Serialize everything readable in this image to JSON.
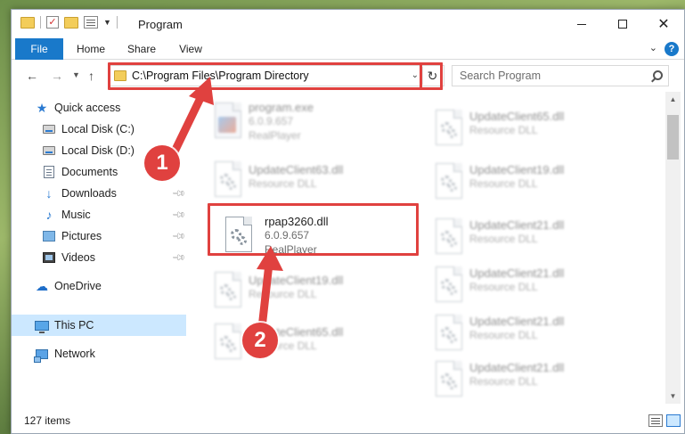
{
  "window": {
    "title": "Program",
    "minimize_icon": "minimize-icon",
    "maximize_icon": "maximize-icon",
    "close_glyph": "✕"
  },
  "ribbon": {
    "tabs": [
      "File",
      "Home",
      "Share",
      "View"
    ],
    "help_glyph": "?"
  },
  "address": {
    "path": "C:\\Program Files\\Program Directory",
    "refresh_glyph": "↻"
  },
  "search": {
    "placeholder": "Search Program"
  },
  "sidebar": {
    "items": [
      {
        "label": "Quick access",
        "icon": "star-icon",
        "pinned": false
      },
      {
        "label": "Local Disk (C:)",
        "icon": "drive-icon",
        "pinned": false
      },
      {
        "label": "Local Disk (D:)",
        "icon": "drive-icon",
        "pinned": false
      },
      {
        "label": "Documents",
        "icon": "documents-icon",
        "pinned": false
      },
      {
        "label": "Downloads",
        "icon": "download-icon",
        "pinned": true
      },
      {
        "label": "Music",
        "icon": "music-icon",
        "pinned": true
      },
      {
        "label": "Pictures",
        "icon": "pictures-icon",
        "pinned": true
      },
      {
        "label": "Videos",
        "icon": "videos-icon",
        "pinned": true
      },
      {
        "label": "OneDrive",
        "icon": "onedrive-icon",
        "pinned": false
      },
      {
        "label": "This PC",
        "icon": "this-pc-icon",
        "pinned": false,
        "selected": true
      },
      {
        "label": "Network",
        "icon": "network-icon",
        "pinned": false
      }
    ]
  },
  "files": {
    "left": [
      {
        "name": "program.exe",
        "version": "6.0.9.657",
        "type": "RealPlayer",
        "blurred": true,
        "exe": true
      },
      {
        "name": "UpdateClient63.dll",
        "version": "",
        "type": "Resource DLL",
        "blurred": true
      },
      {
        "name": "rpap3260.dll",
        "version": "6.0.9.657",
        "type": "RealPlayer",
        "blurred": false
      },
      {
        "name": "UpdateClient19.dll",
        "version": "",
        "type": "Resource DLL",
        "blurred": true
      },
      {
        "name": "UpdateClient65.dll",
        "version": "",
        "type": "Resource DLL",
        "blurred": true
      }
    ],
    "right": [
      {
        "name": "UpdateClient65.dll",
        "version": "",
        "type": "Resource DLL",
        "blurred": true
      },
      {
        "name": "UpdateClient19.dll",
        "version": "",
        "type": "Resource DLL",
        "blurred": true
      },
      {
        "name": "UpdateClient21.dll",
        "version": "",
        "type": "Resource DLL",
        "blurred": true
      },
      {
        "name": "UpdateClient21.dll",
        "version": "",
        "type": "Resource DLL",
        "blurred": true
      },
      {
        "name": "UpdateClient21.dll",
        "version": "",
        "type": "Resource DLL",
        "blurred": true
      },
      {
        "name": "UpdateClient21.dll",
        "version": "",
        "type": "Resource DLL",
        "blurred": true
      }
    ]
  },
  "status": {
    "item_count": "127 items"
  },
  "annotations": {
    "step1": "1",
    "step2": "2",
    "color": "#e0413f"
  }
}
